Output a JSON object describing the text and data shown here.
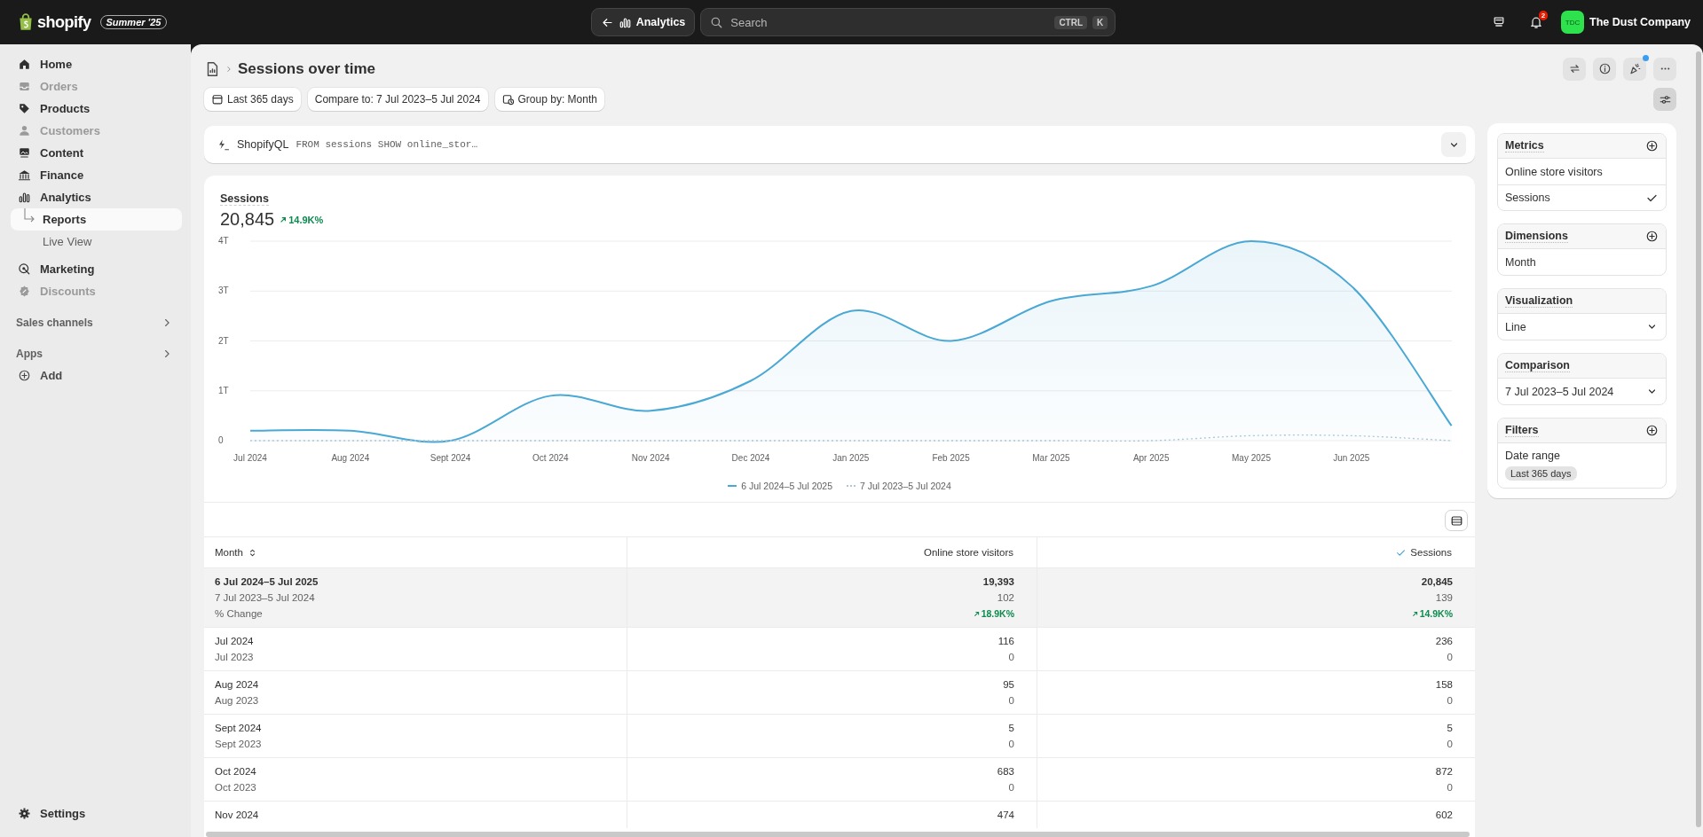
{
  "top_bar": {
    "logo": "shopify",
    "edition_badge": "Summer '25",
    "back_button": "Analytics",
    "search": {
      "placeholder": "Search",
      "shortcut": [
        "CTRL",
        "K"
      ]
    },
    "notification_count": "2",
    "store": {
      "initials": "TDC",
      "name": "The Dust Company"
    }
  },
  "sidebar": {
    "items": [
      {
        "label": "Home",
        "disabled": false,
        "selected": false
      },
      {
        "label": "Orders",
        "disabled": true,
        "selected": false
      },
      {
        "label": "Products",
        "disabled": false,
        "selected": false
      },
      {
        "label": "Customers",
        "disabled": true,
        "selected": false
      },
      {
        "label": "Content",
        "disabled": false,
        "selected": false
      },
      {
        "label": "Finance",
        "disabled": false,
        "selected": false
      },
      {
        "label": "Analytics",
        "disabled": false,
        "selected": false,
        "children": [
          {
            "label": "Reports",
            "selected": true
          },
          {
            "label": "Live View",
            "selected": false
          }
        ]
      },
      {
        "label": "Marketing",
        "disabled": false,
        "selected": false
      },
      {
        "label": "Discounts",
        "disabled": true,
        "selected": false
      }
    ],
    "sections": [
      {
        "title": "Sales channels"
      },
      {
        "title": "Apps",
        "items": [
          {
            "label": "Add"
          }
        ]
      }
    ],
    "settings": "Settings"
  },
  "page": {
    "title": "Sessions over time",
    "filters": [
      "Last 365 days",
      "Compare to: 7 Jul 2023–5 Jul 2024",
      "Group by: Month"
    ],
    "query": {
      "label": "ShopifyQL",
      "code": "FROM sessions SHOW online_stor…"
    },
    "metric": {
      "label": "Sessions",
      "value": "20,845",
      "change": "14.9K%"
    },
    "chart_data": {
      "type": "area",
      "grid": true,
      "legend": true,
      "categories": [
        "Jul 2024",
        "Aug 2024",
        "Sept 2024",
        "Oct 2024",
        "Nov 2024",
        "Dec 2024",
        "Jan 2025",
        "Feb 2025",
        "Mar 2025",
        "Apr 2025",
        "May 2025",
        "Jun 2025",
        null
      ],
      "ylim": [
        0,
        4
      ],
      "yticks": [
        {
          "value": 0,
          "label": "0"
        },
        {
          "value": 1,
          "label": "1T"
        },
        {
          "value": 2,
          "label": "2T"
        },
        {
          "value": 3,
          "label": "3T"
        },
        {
          "value": 4,
          "label": "4T"
        }
      ],
      "series": [
        {
          "name": "6 Jul 2024–5 Jul 2025",
          "color": "#4aa8d4",
          "values": [
            0.2,
            0.2,
            0,
            0.9,
            0.6,
            1.2,
            2.6,
            2.0,
            2.8,
            3.1,
            4.0,
            3.1,
            0.3
          ]
        },
        {
          "name": "7 Jul 2023–5 Jul 2024",
          "color": "#a9c9d8",
          "type": "line",
          "line_style": "dotted",
          "values": [
            0,
            0,
            0,
            0,
            0,
            0,
            0,
            0,
            0,
            0,
            0.1,
            0.1,
            0
          ]
        }
      ]
    },
    "table": {
      "columns": [
        {
          "label": "Month",
          "sortable": true,
          "checked": false
        },
        {
          "label": "Online store visitors",
          "sortable": false,
          "checked": false
        },
        {
          "label": "Sessions",
          "sortable": false,
          "checked": true
        }
      ],
      "summary": {
        "current": [
          "6 Jul 2024–5 Jul 2025",
          "19,393",
          "20,845"
        ],
        "previous": [
          "7 Jul 2023–5 Jul 2024",
          "102",
          "139"
        ],
        "change": [
          "% Change",
          "18.9K%",
          "14.9K%"
        ]
      },
      "rows": [
        {
          "month": "Jul 2024",
          "compare_month": "Jul 2023",
          "visitors": [
            "116",
            "0"
          ],
          "sessions": [
            "236",
            "0"
          ]
        },
        {
          "month": "Aug 2024",
          "compare_month": "Aug 2023",
          "visitors": [
            "95",
            "0"
          ],
          "sessions": [
            "158",
            "0"
          ]
        },
        {
          "month": "Sept 2024",
          "compare_month": "Sept 2023",
          "visitors": [
            "5",
            "0"
          ],
          "sessions": [
            "5",
            "0"
          ]
        },
        {
          "month": "Oct 2024",
          "compare_month": "Oct 2023",
          "visitors": [
            "683",
            "0"
          ],
          "sessions": [
            "872",
            "0"
          ]
        },
        {
          "month": "Nov 2024",
          "visitors": [
            "474"
          ],
          "sessions": [
            "602"
          ]
        }
      ]
    }
  },
  "panel": {
    "sections": [
      {
        "title": "Metrics",
        "kind": "list",
        "addable": true,
        "items": [
          {
            "label": "Online store visitors",
            "checked": false
          },
          {
            "label": "Sessions",
            "checked": true
          }
        ]
      },
      {
        "title": "Dimensions",
        "kind": "list",
        "addable": true,
        "items": [
          {
            "label": "Month",
            "checked": false
          }
        ]
      },
      {
        "title": "Visualization",
        "kind": "select",
        "addable": false,
        "value": "Line"
      },
      {
        "title": "Comparison",
        "kind": "select",
        "addable": false,
        "value": "7 Jul 2023–5 Jul 2024"
      },
      {
        "title": "Filters",
        "kind": "filter",
        "addable": true,
        "label": "Date range",
        "tag": "Last 365 days"
      }
    ]
  }
}
